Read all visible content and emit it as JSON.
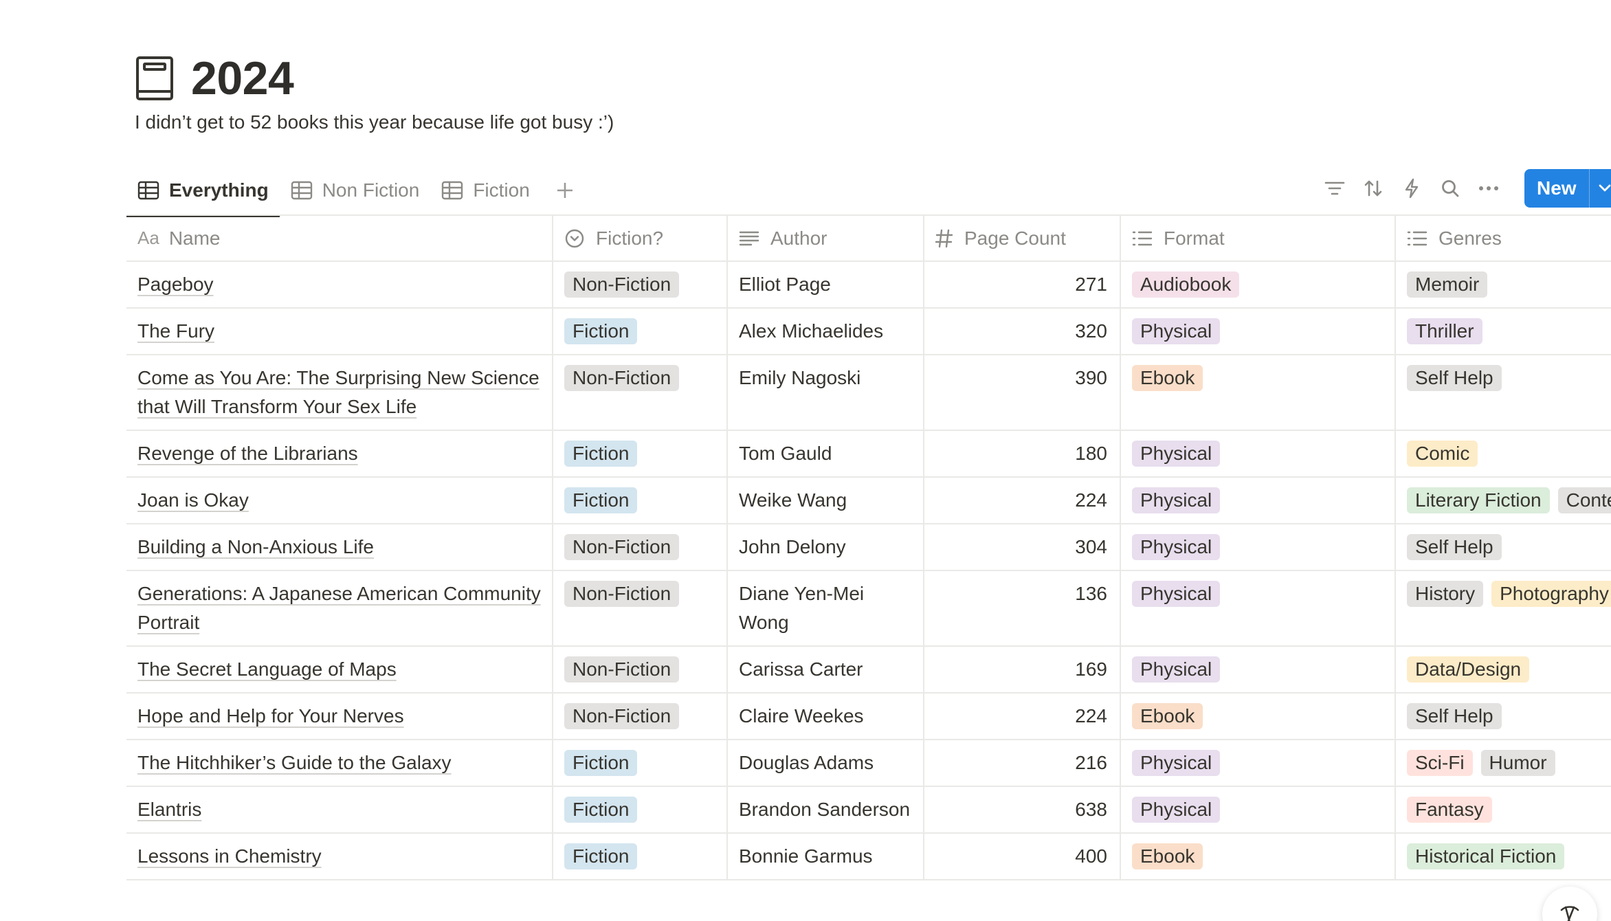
{
  "page": {
    "icon": "book-icon",
    "title": "2024",
    "description": "I didn’t get to 52 books this year because life got busy :’)"
  },
  "tabs": [
    {
      "label": "Everything",
      "icon": "table-icon",
      "active": true
    },
    {
      "label": "Non Fiction",
      "icon": "table-icon",
      "active": false
    },
    {
      "label": "Fiction",
      "icon": "table-icon",
      "active": false
    }
  ],
  "toolbar": {
    "icons": [
      "filter-icon",
      "sort-icon",
      "automation-icon",
      "search-icon",
      "more-icon"
    ],
    "new_label": "New"
  },
  "columns": [
    {
      "label": "Name",
      "icon": "text-icon",
      "icon_text": "Aa"
    },
    {
      "label": "Fiction?",
      "icon": "select-icon"
    },
    {
      "label": "Author",
      "icon": "text-lines-icon"
    },
    {
      "label": "Page Count",
      "icon": "number-icon"
    },
    {
      "label": "Format",
      "icon": "multi-select-icon"
    },
    {
      "label": "Genres",
      "icon": "multi-select-icon"
    }
  ],
  "tag_colors": {
    "Non-Fiction": "#e3e2e0",
    "Fiction": "#d3e5ef",
    "Audiobook": "#f5e0e9",
    "Physical": "#e8deee",
    "Ebook": "#fadec9",
    "Memoir": "#e3e2e0",
    "Thriller": "#e8deee",
    "Self Help": "#e3e2e0",
    "Comic": "#fdecc8",
    "Literary Fiction": "#dbeddb",
    "Contemporary": "#e3e2e0",
    "History": "#e3e2e0",
    "Photography": "#fdecc8",
    "Data/Design": "#fdecc8",
    "Sci-Fi": "#ffe2dd",
    "Humor": "#e3e2e0",
    "Fantasy": "#ffe2dd",
    "Historical Fiction": "#dbeddb"
  },
  "rows": [
    {
      "name": "Pageboy",
      "fiction": "Non-Fiction",
      "author": "Elliot Page",
      "pages": "271",
      "format": [
        "Audiobook"
      ],
      "genres": [
        "Memoir"
      ]
    },
    {
      "name": "The Fury",
      "fiction": "Fiction",
      "author": "Alex Michaelides",
      "pages": "320",
      "format": [
        "Physical"
      ],
      "genres": [
        "Thriller"
      ]
    },
    {
      "name": "Come as You Are: The Surprising New Science that Will Transform Your Sex Life",
      "fiction": "Non-Fiction",
      "author": "Emily Nagoski",
      "pages": "390",
      "format": [
        "Ebook"
      ],
      "genres": [
        "Self Help"
      ]
    },
    {
      "name": "Revenge of the Librarians",
      "fiction": "Fiction",
      "author": "Tom Gauld",
      "pages": "180",
      "format": [
        "Physical"
      ],
      "genres": [
        "Comic"
      ]
    },
    {
      "name": "Joan is Okay",
      "fiction": "Fiction",
      "author": "Weike Wang",
      "pages": "224",
      "format": [
        "Physical"
      ],
      "genres": [
        "Literary Fiction",
        "Contemporary"
      ]
    },
    {
      "name": "Building a Non-Anxious Life",
      "fiction": "Non-Fiction",
      "author": "John Delony",
      "pages": "304",
      "format": [
        "Physical"
      ],
      "genres": [
        "Self Help"
      ]
    },
    {
      "name": "Generations: A Japanese American Community Portrait",
      "fiction": "Non-Fiction",
      "author": "Diane Yen-Mei Wong",
      "pages": "136",
      "format": [
        "Physical"
      ],
      "genres": [
        "History",
        "Photography"
      ]
    },
    {
      "name": "The Secret Language of Maps",
      "fiction": "Non-Fiction",
      "author": "Carissa Carter",
      "pages": "169",
      "format": [
        "Physical"
      ],
      "genres": [
        "Data/Design"
      ]
    },
    {
      "name": "Hope and Help for Your Nerves",
      "fiction": "Non-Fiction",
      "author": "Claire Weekes",
      "pages": "224",
      "format": [
        "Ebook"
      ],
      "genres": [
        "Self Help"
      ]
    },
    {
      "name": "The Hitchhiker’s Guide to the Galaxy",
      "fiction": "Fiction",
      "author": "Douglas Adams",
      "pages": "216",
      "format": [
        "Physical"
      ],
      "genres": [
        "Sci-Fi",
        "Humor"
      ]
    },
    {
      "name": "Elantris",
      "fiction": "Fiction",
      "author": "Brandon Sanderson",
      "pages": "638",
      "format": [
        "Physical"
      ],
      "genres": [
        "Fantasy"
      ]
    },
    {
      "name": "Lessons in Chemistry",
      "fiction": "Fiction",
      "author": "Bonnie Garmus",
      "pages": "400",
      "format": [
        "Ebook"
      ],
      "genres": [
        "Historical Fiction"
      ]
    }
  ]
}
